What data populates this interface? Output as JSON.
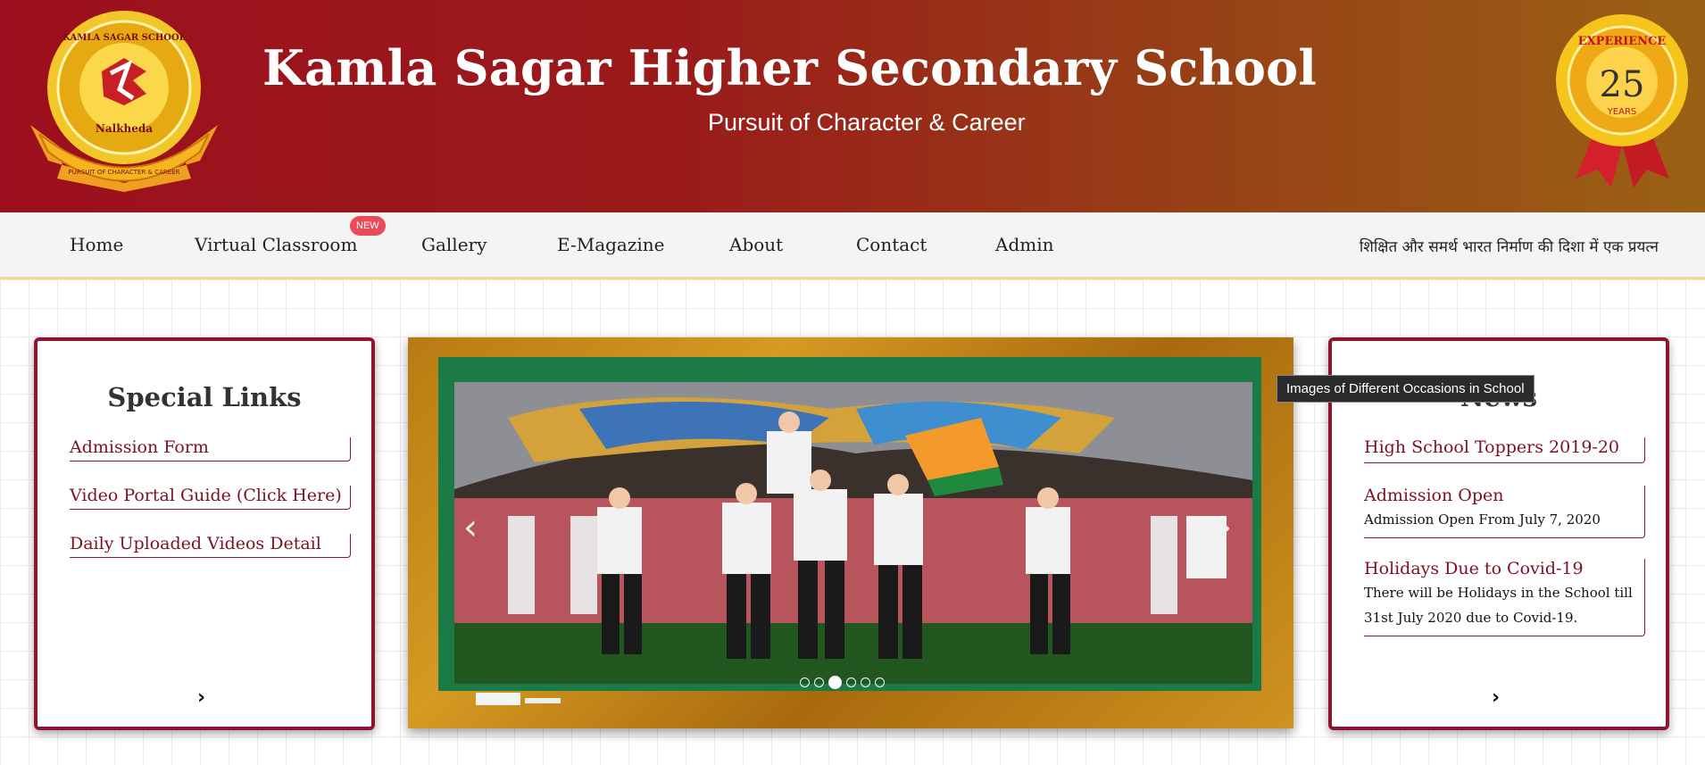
{
  "header": {
    "title": "Kamla Sagar Higher Secondary School",
    "tagline": "Pursuit of Character & Career",
    "logo": {
      "top": "KAMLA SAGAR SCHOOL",
      "bottom": "Nalkheda",
      "ribbon": "PURSUIT OF CHARACTER & CAREER"
    },
    "badge": {
      "top": "EXPERIENCE",
      "number": "25",
      "bottom": "YEARS"
    }
  },
  "nav": {
    "items": [
      "Home",
      "Virtual Classroom",
      "Gallery",
      "E-Magazine",
      "About",
      "Contact",
      "Admin"
    ],
    "new_badge": "NEW",
    "slogan": "शिक्षित और समर्थ भारत निर्माण की दिशा में एक प्रयत्न"
  },
  "special_links": {
    "title": "Special Links",
    "items": [
      "Admission Form",
      "Video Portal Guide (Click Here)",
      "Daily Uploaded Videos Detail"
    ]
  },
  "news": {
    "title": "News",
    "items": [
      {
        "title": "High School Toppers 2019-20",
        "body": ""
      },
      {
        "title": "Admission Open",
        "body": "Admission Open From July 7, 2020"
      },
      {
        "title": "Holidays Due to Covid-19",
        "body": "There will be Holidays in the School till 31st July 2020 due to Covid-19."
      }
    ]
  },
  "slider": {
    "tooltip": "Images of Different Occasions in School",
    "slide_count": 6,
    "active_slide": 3
  },
  "colors": {
    "brand": "#9c0f1e",
    "accent": "#8e1532",
    "nav_bg": "#f4f4f4"
  }
}
